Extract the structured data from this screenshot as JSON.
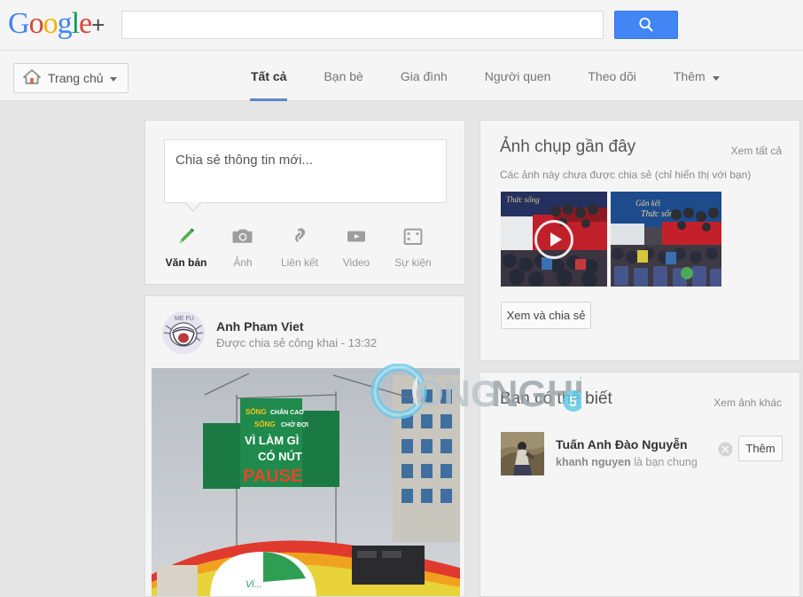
{
  "header": {
    "logo_text": "Google",
    "logo_plus": "+",
    "search": {
      "value": "",
      "placeholder": ""
    },
    "search_button_icon": "search-icon"
  },
  "nav": {
    "home_button": {
      "label": "Trang chủ",
      "icon": "home-icon",
      "chevron": "chevron-down-icon"
    },
    "tabs": [
      {
        "label": "Tất cả",
        "active": true
      },
      {
        "label": "Bạn bè",
        "active": false
      },
      {
        "label": "Gia đình",
        "active": false
      },
      {
        "label": "Người quen",
        "active": false
      },
      {
        "label": "Theo dõi",
        "active": false
      },
      {
        "label": "Thêm",
        "active": false,
        "chevron": "chevron-down-icon"
      }
    ]
  },
  "share_box": {
    "placeholder": "Chia sẻ thông tin mới...",
    "tools": [
      {
        "label": "Văn bản",
        "icon": "pencil-icon",
        "active": true
      },
      {
        "label": "Ảnh",
        "icon": "camera-icon",
        "active": false
      },
      {
        "label": "Liên kết",
        "icon": "link-icon",
        "active": false
      },
      {
        "label": "Video",
        "icon": "video-icon",
        "active": false
      },
      {
        "label": "Sự kiện",
        "icon": "calendar-icon",
        "active": false
      }
    ]
  },
  "post": {
    "author": "Anh Pham Viet",
    "meta": "Được chia sẻ công khai  -  13:32",
    "avatar_alt": "rage-face-avatar",
    "photo_alt": "outdoor-stage-event-photo"
  },
  "recent_photos": {
    "title": "Ảnh chụp gần đây",
    "link": "Xem tất cả",
    "subtitle": "Các ảnh này chưa được chia sẻ (chỉ hiển thị với bạn)",
    "thumbnails": [
      {
        "alt": "concert-indoor-video-thumbnail",
        "has_video": true
      },
      {
        "alt": "event-crowd-photo",
        "has_video": false
      }
    ],
    "button": "Xem và chia sẻ"
  },
  "people_you_may_know": {
    "title": "Bạn có thể biết",
    "link": "Xem ảnh khác",
    "people": [
      {
        "name": "Tuấn Anh Đào Nguyễn",
        "mutual_name": "khanh nguyen",
        "mutual_text": " là bạn chung",
        "add_label": "Thêm",
        "dismiss_icon": "close-circle-icon"
      }
    ]
  },
  "watermark": {
    "text": "CÔNGNGHỆ",
    "badge": "5"
  },
  "colors": {
    "page_bg": "#e5e5e5",
    "card_bg": "#f5f5f5",
    "accent_blue": "#4285f4",
    "tab_underline": "#5b87c7",
    "google_blue": "#4285f4",
    "google_red": "#db4437",
    "google_yellow": "#f4b400",
    "google_green": "#0f9d58",
    "pencil_green": "#52b155",
    "watermark_cyan": "#5fc8e8"
  }
}
